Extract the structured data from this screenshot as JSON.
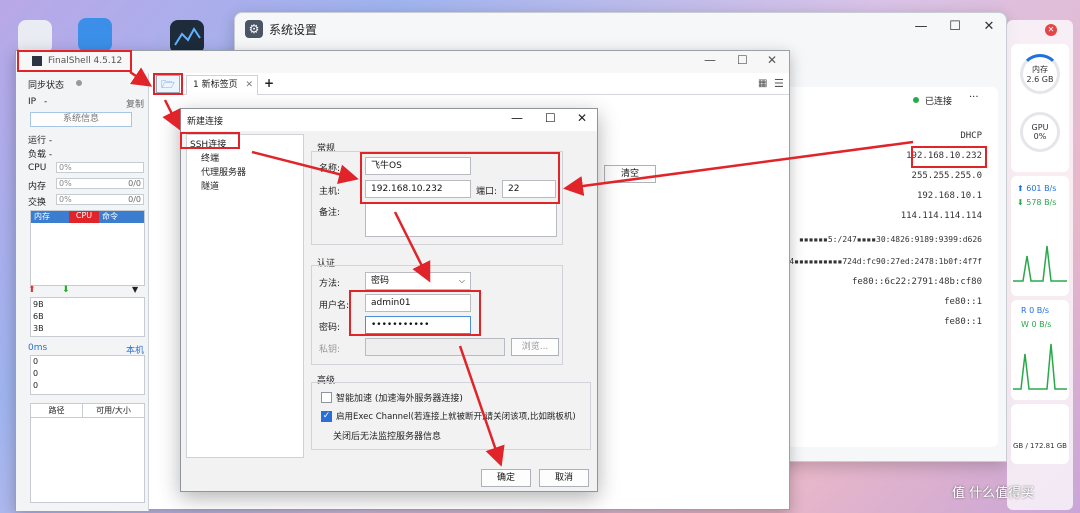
{
  "colors": {
    "annotation_red": "#e0242a",
    "accent_blue": "#1f6fdf",
    "online_green": "#2aa84a"
  },
  "system_settings": {
    "title": "系统设置",
    "status": "已连接",
    "more": "···",
    "network": {
      "mode": "DHCP",
      "ip": "192.168.10.232",
      "mask": "255.255.255.0",
      "gateway": "192.168.10.1",
      "dns": "114.114.114.114",
      "ipv6_a": "▪▪▪▪▪▪5:/247▪▪▪▪30:4826:9189:9399:d626",
      "ipv6_b": "24▪▪▪▪▪▪▪▪▪▪724d:fc90:27ed:2478:1b0f:4f7f",
      "ipv6_c": "fe80::6c22:2791:48b:cf80",
      "ipv6_d": "fe80::1",
      "ipv6_e": "fe80::1"
    }
  },
  "widgets": {
    "mem_label": "内存",
    "mem_value": "2.6 GB",
    "gpu_label": "GPU",
    "gpu_value": "0%",
    "net_up": "601 B/s",
    "net_down": "578 B/s",
    "disk_r": "R  0 B/s",
    "disk_w": "W  0 B/s",
    "storage": "GB / 172.81 GB"
  },
  "finalshell": {
    "title": "FinalShell 4.5.12",
    "tab": "1 新标签页",
    "add_tab": "+",
    "sidebar": {
      "sync": "同步状态",
      "ip_label": "IP",
      "ip_value": "-",
      "copy": "复制",
      "sysinfo": "系统信息",
      "run": "运行 -",
      "load": "负载 -",
      "cpu": "CPU",
      "cpu_val": "0%",
      "mem": "内存",
      "mem_val": "0%",
      "mem_rt": "0/0",
      "swap": "交换",
      "swap_val": "0%",
      "swap_rt": "0/0",
      "proc_tabs": [
        "内存",
        "CPU",
        "命令"
      ],
      "net_scale": [
        "9B",
        "6B",
        "3B"
      ],
      "ping": "0ms",
      "ping_target": "本机",
      "ping_vals": [
        "0",
        "0",
        "0"
      ],
      "path_col": "路径",
      "size_col": "可用/大小"
    },
    "clear": "清空"
  },
  "dialog": {
    "title": "新建连接",
    "tree": {
      "root": "SSH连接",
      "children": [
        "终端",
        "代理服务器",
        "隧道"
      ]
    },
    "general": {
      "legend": "常规",
      "name_label": "名称:",
      "name": "飞牛OS",
      "host_label": "主机:",
      "host": "192.168.10.232",
      "port_label": "端口:",
      "port": "22",
      "note_label": "备注:"
    },
    "auth": {
      "legend": "认证",
      "method_label": "方法:",
      "method": "密码",
      "user_label": "用户名:",
      "user": "admin01",
      "pass_label": "密码:",
      "pass": "•••••••••••",
      "key_label": "私钥:",
      "browse": "浏览..."
    },
    "advanced": {
      "legend": "高级",
      "smart": "智能加速 (加速海外服务器连接)",
      "exec": "启用Exec Channel(若连接上就被断开,请关闭该项,比如跳板机)",
      "note": "关闭后无法监控服务器信息"
    },
    "ok": "确定",
    "cancel": "取消"
  },
  "watermark": "值 什么值得买"
}
